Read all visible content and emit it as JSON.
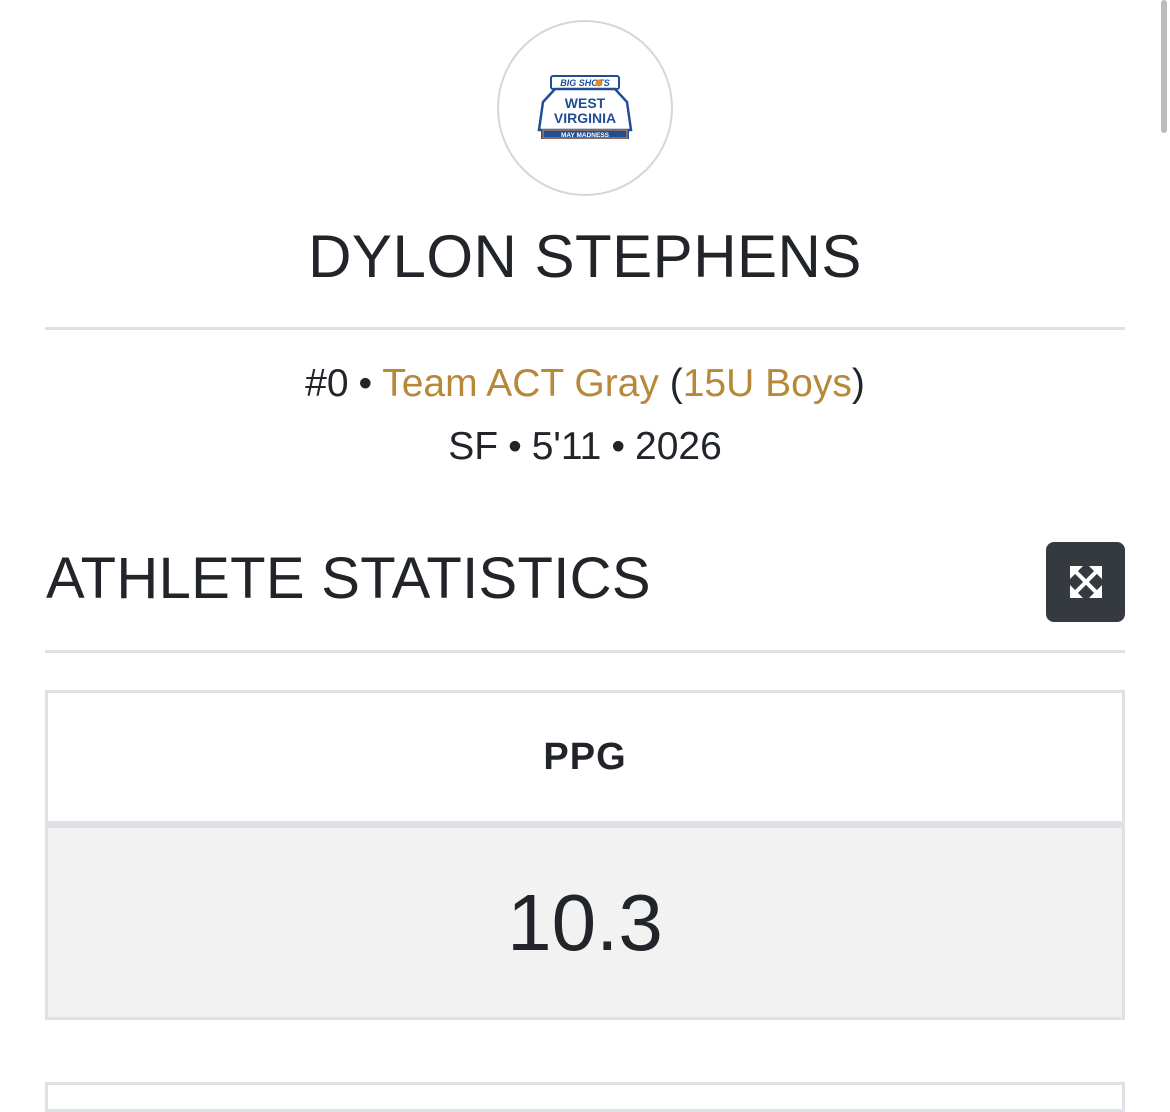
{
  "logo": {
    "line1": "BIG SHOTS",
    "line2": "WEST",
    "line3": "VIRGINIA",
    "line4": "MAY MADNESS"
  },
  "player": {
    "name": "DYLON STEPHENS",
    "number": "#0",
    "team": "Team ACT Gray",
    "division": "15U Boys",
    "position": "SF",
    "height": "5'11",
    "class_year": "2026"
  },
  "separator": "•",
  "section": {
    "title": "ATHLETE STATISTICS",
    "expand_icon": "expand-arrows-icon"
  },
  "stats": {
    "header": "PPG",
    "value": "10.3"
  },
  "colors": {
    "accent_link": "#b8883a",
    "dark_button": "#343a40",
    "logo_blue": "#1f4e96",
    "logo_orange": "#e8862a"
  }
}
